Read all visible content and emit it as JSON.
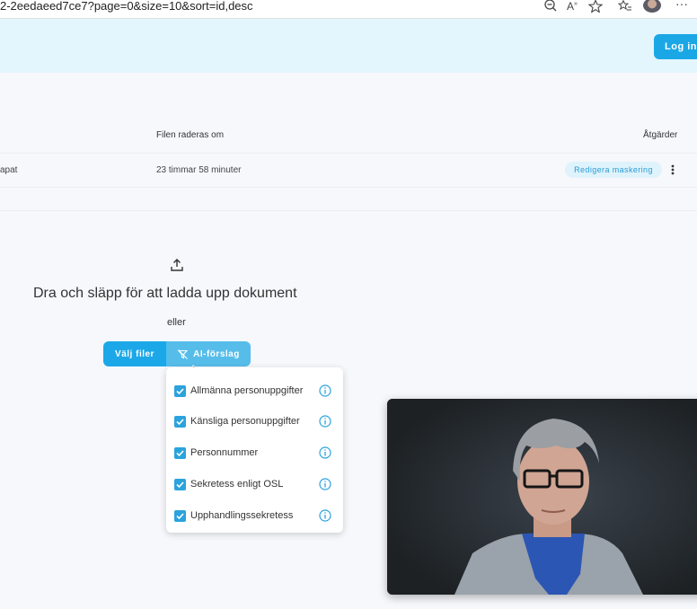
{
  "browser": {
    "url": "2-2eedaeed7ce7?page=0&size=10&sort=id,desc",
    "more_label": "···"
  },
  "header": {
    "login_label": "Log in"
  },
  "table": {
    "col_deleted_in": "Filen raderas om",
    "col_actions": "Åtgärder",
    "rows": [
      {
        "name_fragment": "apat",
        "deleted_in": "23 timmar 58 minuter",
        "action_label": "Redigera maskering"
      }
    ]
  },
  "upload": {
    "title": "Dra och släpp för att ladda upp dokument",
    "or": "eller",
    "choose_files": "Välj filer",
    "ai_suggestions": "AI-förslag"
  },
  "dropdown": {
    "options": [
      {
        "label": "Allmänna personuppgifter",
        "checked": true
      },
      {
        "label": "Känsliga personuppgifter",
        "checked": true
      },
      {
        "label": "Personnummer",
        "checked": true
      },
      {
        "label": "Sekretess enligt OSL",
        "checked": true
      },
      {
        "label": "Upphandlingssekretess",
        "checked": true
      }
    ]
  },
  "colors": {
    "accent": "#1ca8e8",
    "header_bg": "#e3f6fd",
    "chip_bg": "#dff3fc"
  }
}
